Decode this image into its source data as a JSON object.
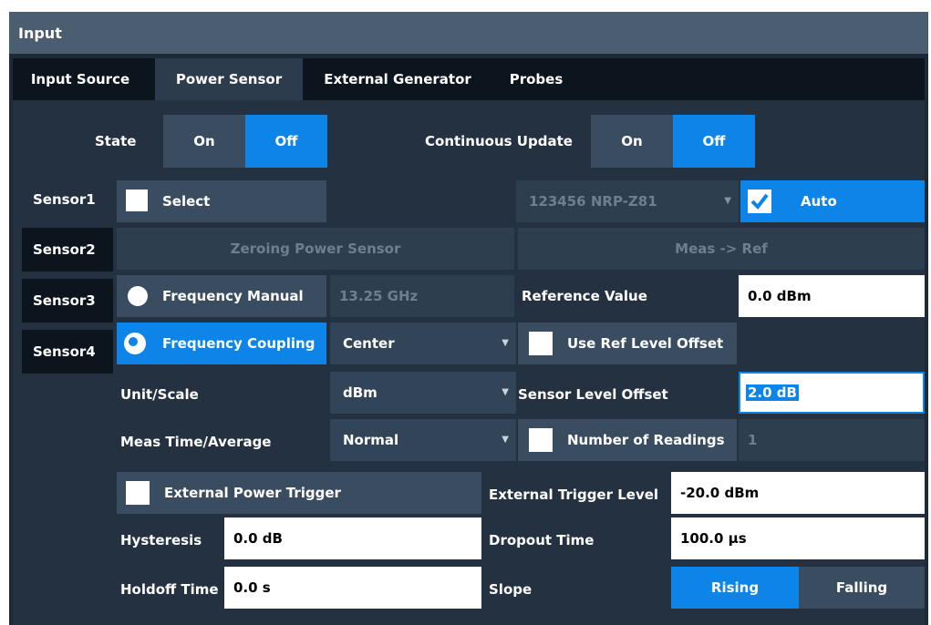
{
  "window": {
    "title": "Input"
  },
  "tabs": [
    {
      "label": "Input Source"
    },
    {
      "label": "Power Sensor"
    },
    {
      "label": "External Generator"
    },
    {
      "label": "Probes"
    }
  ],
  "state": {
    "label": "State",
    "on": "On",
    "off": "Off",
    "selected": "Off"
  },
  "continuous_update": {
    "label": "Continuous Update",
    "on": "On",
    "off": "Off",
    "selected": "Off"
  },
  "sensors": [
    {
      "label": "Sensor1"
    },
    {
      "label": "Sensor2"
    },
    {
      "label": "Sensor3"
    },
    {
      "label": "Sensor4"
    }
  ],
  "select": {
    "label": "Select",
    "checked": false
  },
  "sensor_model": {
    "value": "123456 NRP-Z81"
  },
  "auto": {
    "label": "Auto",
    "checked": true
  },
  "zeroing_button": "Zeroing Power Sensor",
  "meas_ref_button": "Meas -> Ref",
  "frequency_manual": {
    "label": "Frequency Manual",
    "value": "13.25 GHz",
    "selected": false
  },
  "reference_value": {
    "label": "Reference Value",
    "value": "0.0 dBm"
  },
  "frequency_coupling": {
    "label": "Frequency Coupling",
    "value": "Center",
    "selected": true
  },
  "use_ref_level_offset": {
    "label": "Use Ref Level Offset",
    "checked": false
  },
  "unit_scale": {
    "label": "Unit/Scale",
    "value": "dBm"
  },
  "sensor_level_offset": {
    "label": "Sensor Level Offset",
    "value": "2.0 dB"
  },
  "meas_time": {
    "label": "Meas Time/Average",
    "value": "Normal"
  },
  "number_of_readings": {
    "label": "Number of Readings",
    "value": "1",
    "checked": false
  },
  "external_power_trigger": {
    "label": "External Power Trigger",
    "checked": false
  },
  "external_trigger_level": {
    "label": "External Trigger Level",
    "value": "-20.0 dBm"
  },
  "hysteresis": {
    "label": "Hysteresis",
    "value": "0.0 dB"
  },
  "dropout_time": {
    "label": "Dropout Time",
    "value": "100.0 µs"
  },
  "holdoff_time": {
    "label": "Holdoff Time",
    "value": "0.0 s"
  },
  "slope": {
    "label": "Slope",
    "rising": "Rising",
    "falling": "Falling",
    "selected": "Rising"
  },
  "colors": {
    "accent": "#0d84e8",
    "panel": "#243140",
    "title_bar": "#4b5d70"
  }
}
